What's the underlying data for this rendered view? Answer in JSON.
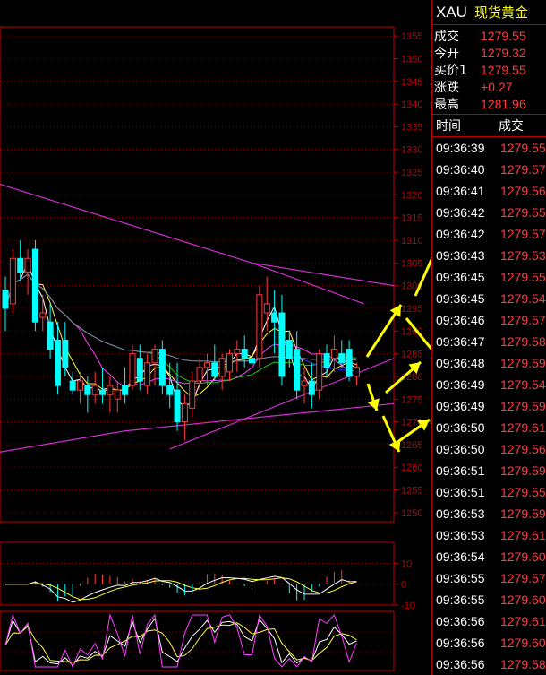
{
  "quote": {
    "symbol": "XAU",
    "name": "现货黄金",
    "rows": [
      {
        "label": "成交",
        "value": "1279.55"
      },
      {
        "label": "今开",
        "value": "1279.32"
      },
      {
        "label": "买价1",
        "value": "1279.55"
      },
      {
        "label": "涨跌",
        "value": "+0.27"
      },
      {
        "label": "最高",
        "value": "1281.96"
      }
    ]
  },
  "ticks": {
    "header_time": "时间",
    "header_price": "成交",
    "rows": [
      {
        "time": "09:36:39",
        "price": "1279.55"
      },
      {
        "time": "09:36:40",
        "price": "1279.57"
      },
      {
        "time": "09:36:41",
        "price": "1279.56"
      },
      {
        "time": "09:36:42",
        "price": "1279.55"
      },
      {
        "time": "09:36:42",
        "price": "1279.57"
      },
      {
        "time": "09:36:43",
        "price": "1279.53"
      },
      {
        "time": "09:36:45",
        "price": "1279.55"
      },
      {
        "time": "09:36:45",
        "price": "1279.54"
      },
      {
        "time": "09:36:46",
        "price": "1279.57"
      },
      {
        "time": "09:36:47",
        "price": "1279.58"
      },
      {
        "time": "09:36:48",
        "price": "1279.59"
      },
      {
        "time": "09:36:49",
        "price": "1279.54"
      },
      {
        "time": "09:36:49",
        "price": "1279.59"
      },
      {
        "time": "09:36:50",
        "price": "1279.61"
      },
      {
        "time": "09:36:50",
        "price": "1279.56"
      },
      {
        "time": "09:36:51",
        "price": "1279.59"
      },
      {
        "time": "09:36:51",
        "price": "1279.55"
      },
      {
        "time": "09:36:53",
        "price": "1279.59"
      },
      {
        "time": "09:36:53",
        "price": "1279.61"
      },
      {
        "time": "09:36:54",
        "price": "1279.60"
      },
      {
        "time": "09:36:55",
        "price": "1279.57"
      },
      {
        "time": "09:36:55",
        "price": "1279.60"
      },
      {
        "time": "09:36:56",
        "price": "1279.61"
      },
      {
        "time": "09:36:56",
        "price": "1279.60"
      },
      {
        "time": "09:36:56",
        "price": "1279.58"
      }
    ]
  },
  "chart_data": [
    {
      "type": "candlestick",
      "title": "",
      "ylim": [
        1248,
        1357
      ],
      "y_ticks": [
        1250,
        1255,
        1260,
        1265,
        1270,
        1275,
        1280,
        1285,
        1290,
        1295,
        1300,
        1305,
        1310,
        1315,
        1320,
        1325,
        1330,
        1335,
        1340,
        1345,
        1350,
        1355
      ],
      "y_tick_labels": [
        "1250",
        "1255",
        "1260",
        "1265",
        "1270",
        "1275",
        "1280",
        "1285",
        "1290",
        "1295",
        "1300",
        "1305",
        "1310",
        "1315",
        "1320",
        "1325",
        "1330",
        "1335",
        "1340",
        "1345",
        "1350",
        "1355"
      ],
      "candles": [
        {
          "o": 1299,
          "h": 1302,
          "l": 1290,
          "c": 1295
        },
        {
          "o": 1296,
          "h": 1308,
          "l": 1294,
          "c": 1306
        },
        {
          "o": 1306,
          "h": 1310,
          "l": 1301,
          "c": 1303
        },
        {
          "o": 1303,
          "h": 1308,
          "l": 1298,
          "c": 1306
        },
        {
          "o": 1308,
          "h": 1310,
          "l": 1290,
          "c": 1292
        },
        {
          "o": 1293,
          "h": 1298,
          "l": 1290,
          "c": 1294
        },
        {
          "o": 1292,
          "h": 1296,
          "l": 1284,
          "c": 1286
        },
        {
          "o": 1288,
          "h": 1292,
          "l": 1276,
          "c": 1278
        },
        {
          "o": 1288,
          "h": 1292,
          "l": 1280,
          "c": 1282
        },
        {
          "o": 1279,
          "h": 1281,
          "l": 1276,
          "c": 1277
        },
        {
          "o": 1277,
          "h": 1281,
          "l": 1274,
          "c": 1279
        },
        {
          "o": 1278,
          "h": 1280,
          "l": 1272,
          "c": 1276
        },
        {
          "o": 1276,
          "h": 1281,
          "l": 1274,
          "c": 1278
        },
        {
          "o": 1277,
          "h": 1282,
          "l": 1274,
          "c": 1276
        },
        {
          "o": 1276,
          "h": 1280,
          "l": 1272,
          "c": 1278
        },
        {
          "o": 1275,
          "h": 1279,
          "l": 1272,
          "c": 1277
        },
        {
          "o": 1278,
          "h": 1282,
          "l": 1274,
          "c": 1276
        },
        {
          "o": 1278,
          "h": 1287,
          "l": 1277,
          "c": 1285
        },
        {
          "o": 1284,
          "h": 1287,
          "l": 1277,
          "c": 1279
        },
        {
          "o": 1278,
          "h": 1285,
          "l": 1276,
          "c": 1283
        },
        {
          "o": 1283,
          "h": 1287,
          "l": 1278,
          "c": 1286
        },
        {
          "o": 1286,
          "h": 1288,
          "l": 1276,
          "c": 1278
        },
        {
          "o": 1278,
          "h": 1283,
          "l": 1273,
          "c": 1276
        },
        {
          "o": 1277,
          "h": 1283,
          "l": 1268,
          "c": 1270
        },
        {
          "o": 1270,
          "h": 1276,
          "l": 1266,
          "c": 1274
        },
        {
          "o": 1273,
          "h": 1281,
          "l": 1271,
          "c": 1279
        },
        {
          "o": 1279,
          "h": 1284,
          "l": 1277,
          "c": 1282
        },
        {
          "o": 1282,
          "h": 1285,
          "l": 1278,
          "c": 1283
        },
        {
          "o": 1283,
          "h": 1287,
          "l": 1279,
          "c": 1280
        },
        {
          "o": 1280,
          "h": 1285,
          "l": 1277,
          "c": 1284
        },
        {
          "o": 1281,
          "h": 1286,
          "l": 1279,
          "c": 1285
        },
        {
          "o": 1285,
          "h": 1288,
          "l": 1281,
          "c": 1286
        },
        {
          "o": 1286,
          "h": 1289,
          "l": 1282,
          "c": 1284
        },
        {
          "o": 1284,
          "h": 1286,
          "l": 1280,
          "c": 1283
        },
        {
          "o": 1284,
          "h": 1300,
          "l": 1282,
          "c": 1298
        },
        {
          "o": 1294,
          "h": 1302,
          "l": 1290,
          "c": 1296
        },
        {
          "o": 1294,
          "h": 1299,
          "l": 1285,
          "c": 1292
        },
        {
          "o": 1294,
          "h": 1298,
          "l": 1278,
          "c": 1280
        },
        {
          "o": 1288,
          "h": 1290,
          "l": 1282,
          "c": 1284
        },
        {
          "o": 1286,
          "h": 1290,
          "l": 1275,
          "c": 1277
        },
        {
          "o": 1278,
          "h": 1282,
          "l": 1274,
          "c": 1279
        },
        {
          "o": 1279,
          "h": 1283,
          "l": 1273,
          "c": 1276
        },
        {
          "o": 1277,
          "h": 1286,
          "l": 1275,
          "c": 1285
        },
        {
          "o": 1285,
          "h": 1287,
          "l": 1280,
          "c": 1282
        },
        {
          "o": 1284,
          "h": 1289,
          "l": 1281,
          "c": 1286
        },
        {
          "o": 1285,
          "h": 1288,
          "l": 1282,
          "c": 1283
        },
        {
          "o": 1286,
          "h": 1288,
          "l": 1279,
          "c": 1280
        },
        {
          "o": 1280,
          "h": 1283,
          "l": 1278,
          "c": 1282
        }
      ]
    },
    {
      "type": "bar",
      "title": "",
      "ylim": [
        -10,
        20
      ],
      "y_ticks": [
        -10,
        0,
        10
      ],
      "y_tick_labels": [
        "-10",
        "0",
        "10"
      ]
    },
    {
      "type": "line",
      "title": "",
      "y_ticks": [],
      "y_tick_labels": []
    }
  ]
}
